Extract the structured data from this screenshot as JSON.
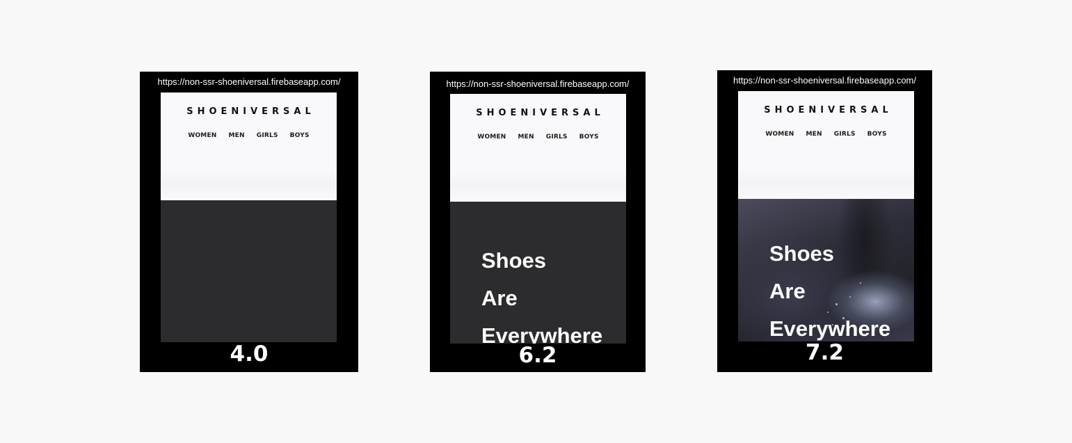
{
  "frames": [
    {
      "url": "https://non-ssr-shoeniversal.firebaseapp.com/",
      "brand": "SHOENIVERSAL",
      "nav": [
        "WOMEN",
        "MEN",
        "GIRLS",
        "BOYS"
      ],
      "headline": [],
      "score": "4.0"
    },
    {
      "url": "https://non-ssr-shoeniversal.firebaseapp.com/",
      "brand": "SHOENIVERSAL",
      "nav": [
        "WOMEN",
        "MEN",
        "GIRLS",
        "BOYS"
      ],
      "headline": [
        "Shoes",
        "Are",
        "Everywhere"
      ],
      "score": "6.2"
    },
    {
      "url": "https://non-ssr-shoeniversal.firebaseapp.com/",
      "brand": "SHOENIVERSAL",
      "nav": [
        "WOMEN",
        "MEN",
        "GIRLS",
        "BOYS"
      ],
      "headline": [
        "Shoes",
        "Are",
        "Everywhere"
      ],
      "score": "7.2"
    }
  ],
  "colors": {
    "background": "#f8f8f8",
    "frame": "#000000",
    "header": "#f9f9fb",
    "hero": "#2c2c2e",
    "text_light": "#ffffff",
    "text_dark": "#111111"
  }
}
